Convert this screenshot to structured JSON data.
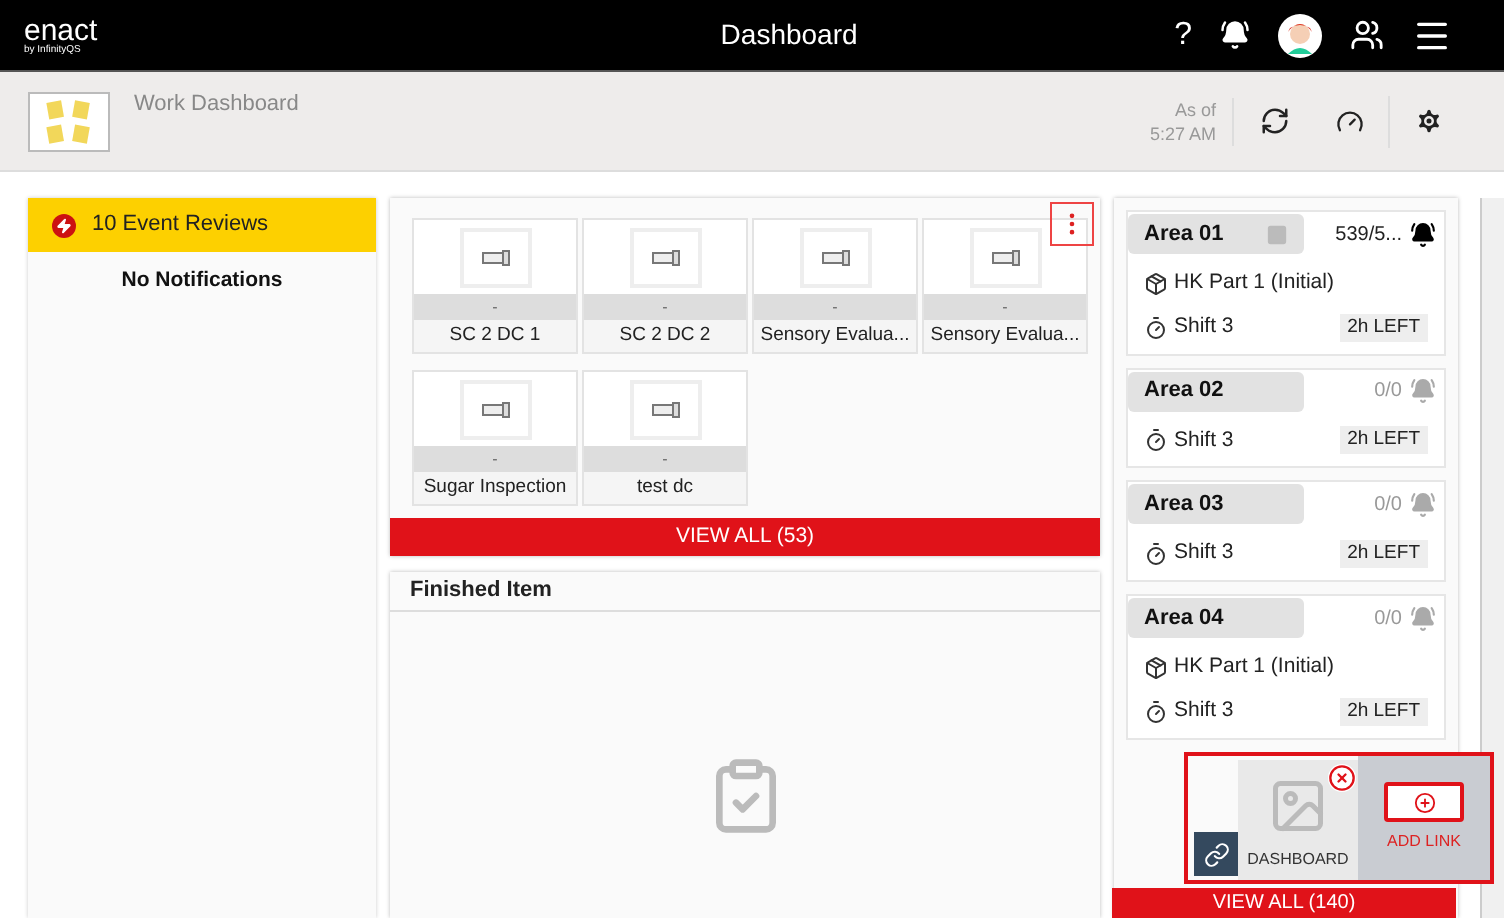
{
  "header": {
    "logo": "enact",
    "logo_sub": "by InfinityQS",
    "title": "Dashboard",
    "help": "?"
  },
  "toolbar": {
    "title": "Work Dashboard",
    "as_of_label": "As of",
    "as_of_time": "5:27 AM"
  },
  "events": {
    "title": "10 Event Reviews",
    "empty": "No Notifications"
  },
  "data_collections": {
    "items": [
      {
        "status": "-",
        "label": "SC 2 DC 1"
      },
      {
        "status": "-",
        "label": "SC 2 DC 2"
      },
      {
        "status": "-",
        "label": "Sensory Evalua..."
      },
      {
        "status": "-",
        "label": "Sensory Evalua..."
      },
      {
        "status": "-",
        "label": "Sugar Inspection"
      },
      {
        "status": "-",
        "label": "test dc"
      }
    ],
    "view_all": "VIEW ALL (53)"
  },
  "finished_item": {
    "title": "Finished Item"
  },
  "areas": {
    "items": [
      {
        "name": "Area 01",
        "pinned": true,
        "count": "539/5...",
        "alarm": true,
        "part": "HK Part 1 (Initial)",
        "shift": "Shift 3",
        "time_left": "2h LEFT"
      },
      {
        "name": "Area 02",
        "pinned": false,
        "count": "0/0",
        "alarm": false,
        "shift": "Shift 3",
        "time_left": "2h LEFT"
      },
      {
        "name": "Area 03",
        "pinned": false,
        "count": "0/0",
        "alarm": false,
        "shift": "Shift 3",
        "time_left": "2h LEFT"
      },
      {
        "name": "Area 04",
        "pinned": false,
        "count": "0/0",
        "alarm": false,
        "part": "HK Part 1 (Initial)",
        "shift": "Shift 3",
        "time_left": "2h LEFT"
      }
    ],
    "view_all": "VIEW ALL (140)"
  },
  "link_popup": {
    "tile_label": "DASHBOARD",
    "add_label": "ADD LINK"
  }
}
